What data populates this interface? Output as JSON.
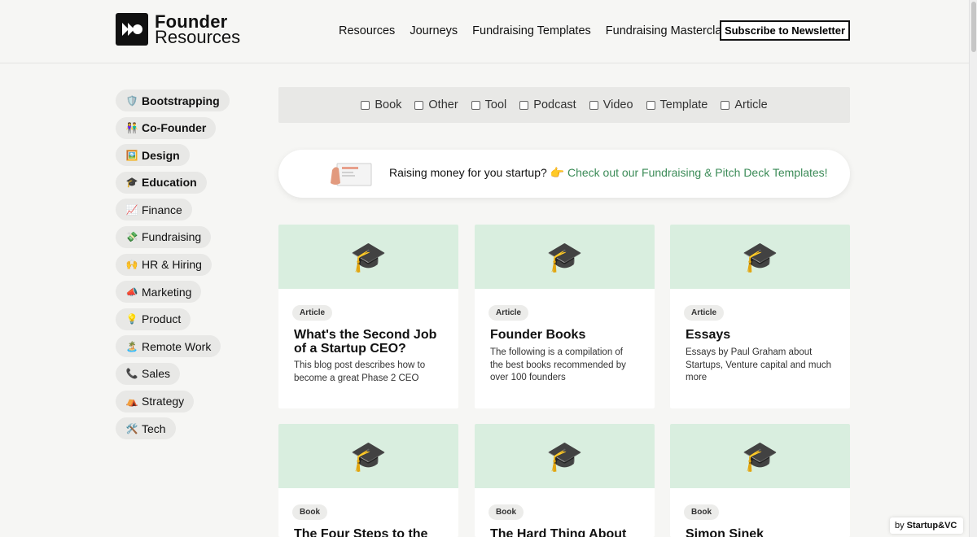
{
  "header": {
    "logo_line1": "Founder",
    "logo_line2": "Resources",
    "nav": [
      "Resources",
      "Journeys",
      "Fundraising Templates",
      "Fundraising Masterclass"
    ],
    "subscribe_label": "Subscribe to Newsletter"
  },
  "sidebar": {
    "items": [
      {
        "icon": "shield-emoji",
        "emoji": "🛡️",
        "label": "Bootstrapping",
        "bold": true
      },
      {
        "icon": "people-emoji",
        "emoji": "👫",
        "label": "Co-Founder",
        "bold": true
      },
      {
        "icon": "picture-emoji",
        "emoji": "🖼️",
        "label": "Design",
        "bold": true
      },
      {
        "icon": "graduation-cap-emoji",
        "emoji": "🎓",
        "label": "Education",
        "bold": true
      },
      {
        "icon": "chart-emoji",
        "emoji": "📈",
        "label": "Finance",
        "bold": false
      },
      {
        "icon": "money-emoji",
        "emoji": "💸",
        "label": "Fundraising",
        "bold": false
      },
      {
        "icon": "raised-hands-emoji",
        "emoji": "🙌",
        "label": "HR & Hiring",
        "bold": false
      },
      {
        "icon": "megaphone-emoji",
        "emoji": "📣",
        "label": "Marketing",
        "bold": false
      },
      {
        "icon": "lightbulb-emoji",
        "emoji": "💡",
        "label": "Product",
        "bold": false
      },
      {
        "icon": "palm-tree-emoji",
        "emoji": "🏝️",
        "label": "Remote Work",
        "bold": false
      },
      {
        "icon": "phone-emoji",
        "emoji": "📞",
        "label": "Sales",
        "bold": false
      },
      {
        "icon": "tent-emoji",
        "emoji": "⛺",
        "label": "Strategy",
        "bold": false
      },
      {
        "icon": "tools-emoji",
        "emoji": "🛠️",
        "label": "Tech",
        "bold": false
      }
    ]
  },
  "filters": [
    "Book",
    "Other",
    "Tool",
    "Podcast",
    "Video",
    "Template",
    "Article"
  ],
  "banner": {
    "text": "Raising money for you startup? 👉 ",
    "link": "Check out our Fundraising & Pitch Deck Templates!"
  },
  "cards": [
    {
      "emoji": "🎓",
      "tag": "Article",
      "title": "What's the Second Job of a Startup CEO?",
      "desc": "This blog post describes how to become a great Phase 2 CEO"
    },
    {
      "emoji": "🎓",
      "tag": "Article",
      "title": "Founder Books",
      "desc": "The following is a compilation of the best books recommended by over 100 founders"
    },
    {
      "emoji": "🎓",
      "tag": "Article",
      "title": "Essays",
      "desc": "Essays by Paul Graham about Startups, Venture capital and much more"
    },
    {
      "emoji": "🎓",
      "tag": "Book",
      "title": "The Four Steps to the",
      "desc": ""
    },
    {
      "emoji": "🎓",
      "tag": "Book",
      "title": "The Hard Thing About",
      "desc": ""
    },
    {
      "emoji": "🎓",
      "tag": "Book",
      "title": "Simon Sinek",
      "desc": ""
    }
  ],
  "badge": {
    "prefix": "by",
    "brand": "Startup&VC"
  },
  "colors": {
    "card_top": "#d9eedf",
    "link": "#3b8b57",
    "pill_bg": "#e8e8e6"
  }
}
